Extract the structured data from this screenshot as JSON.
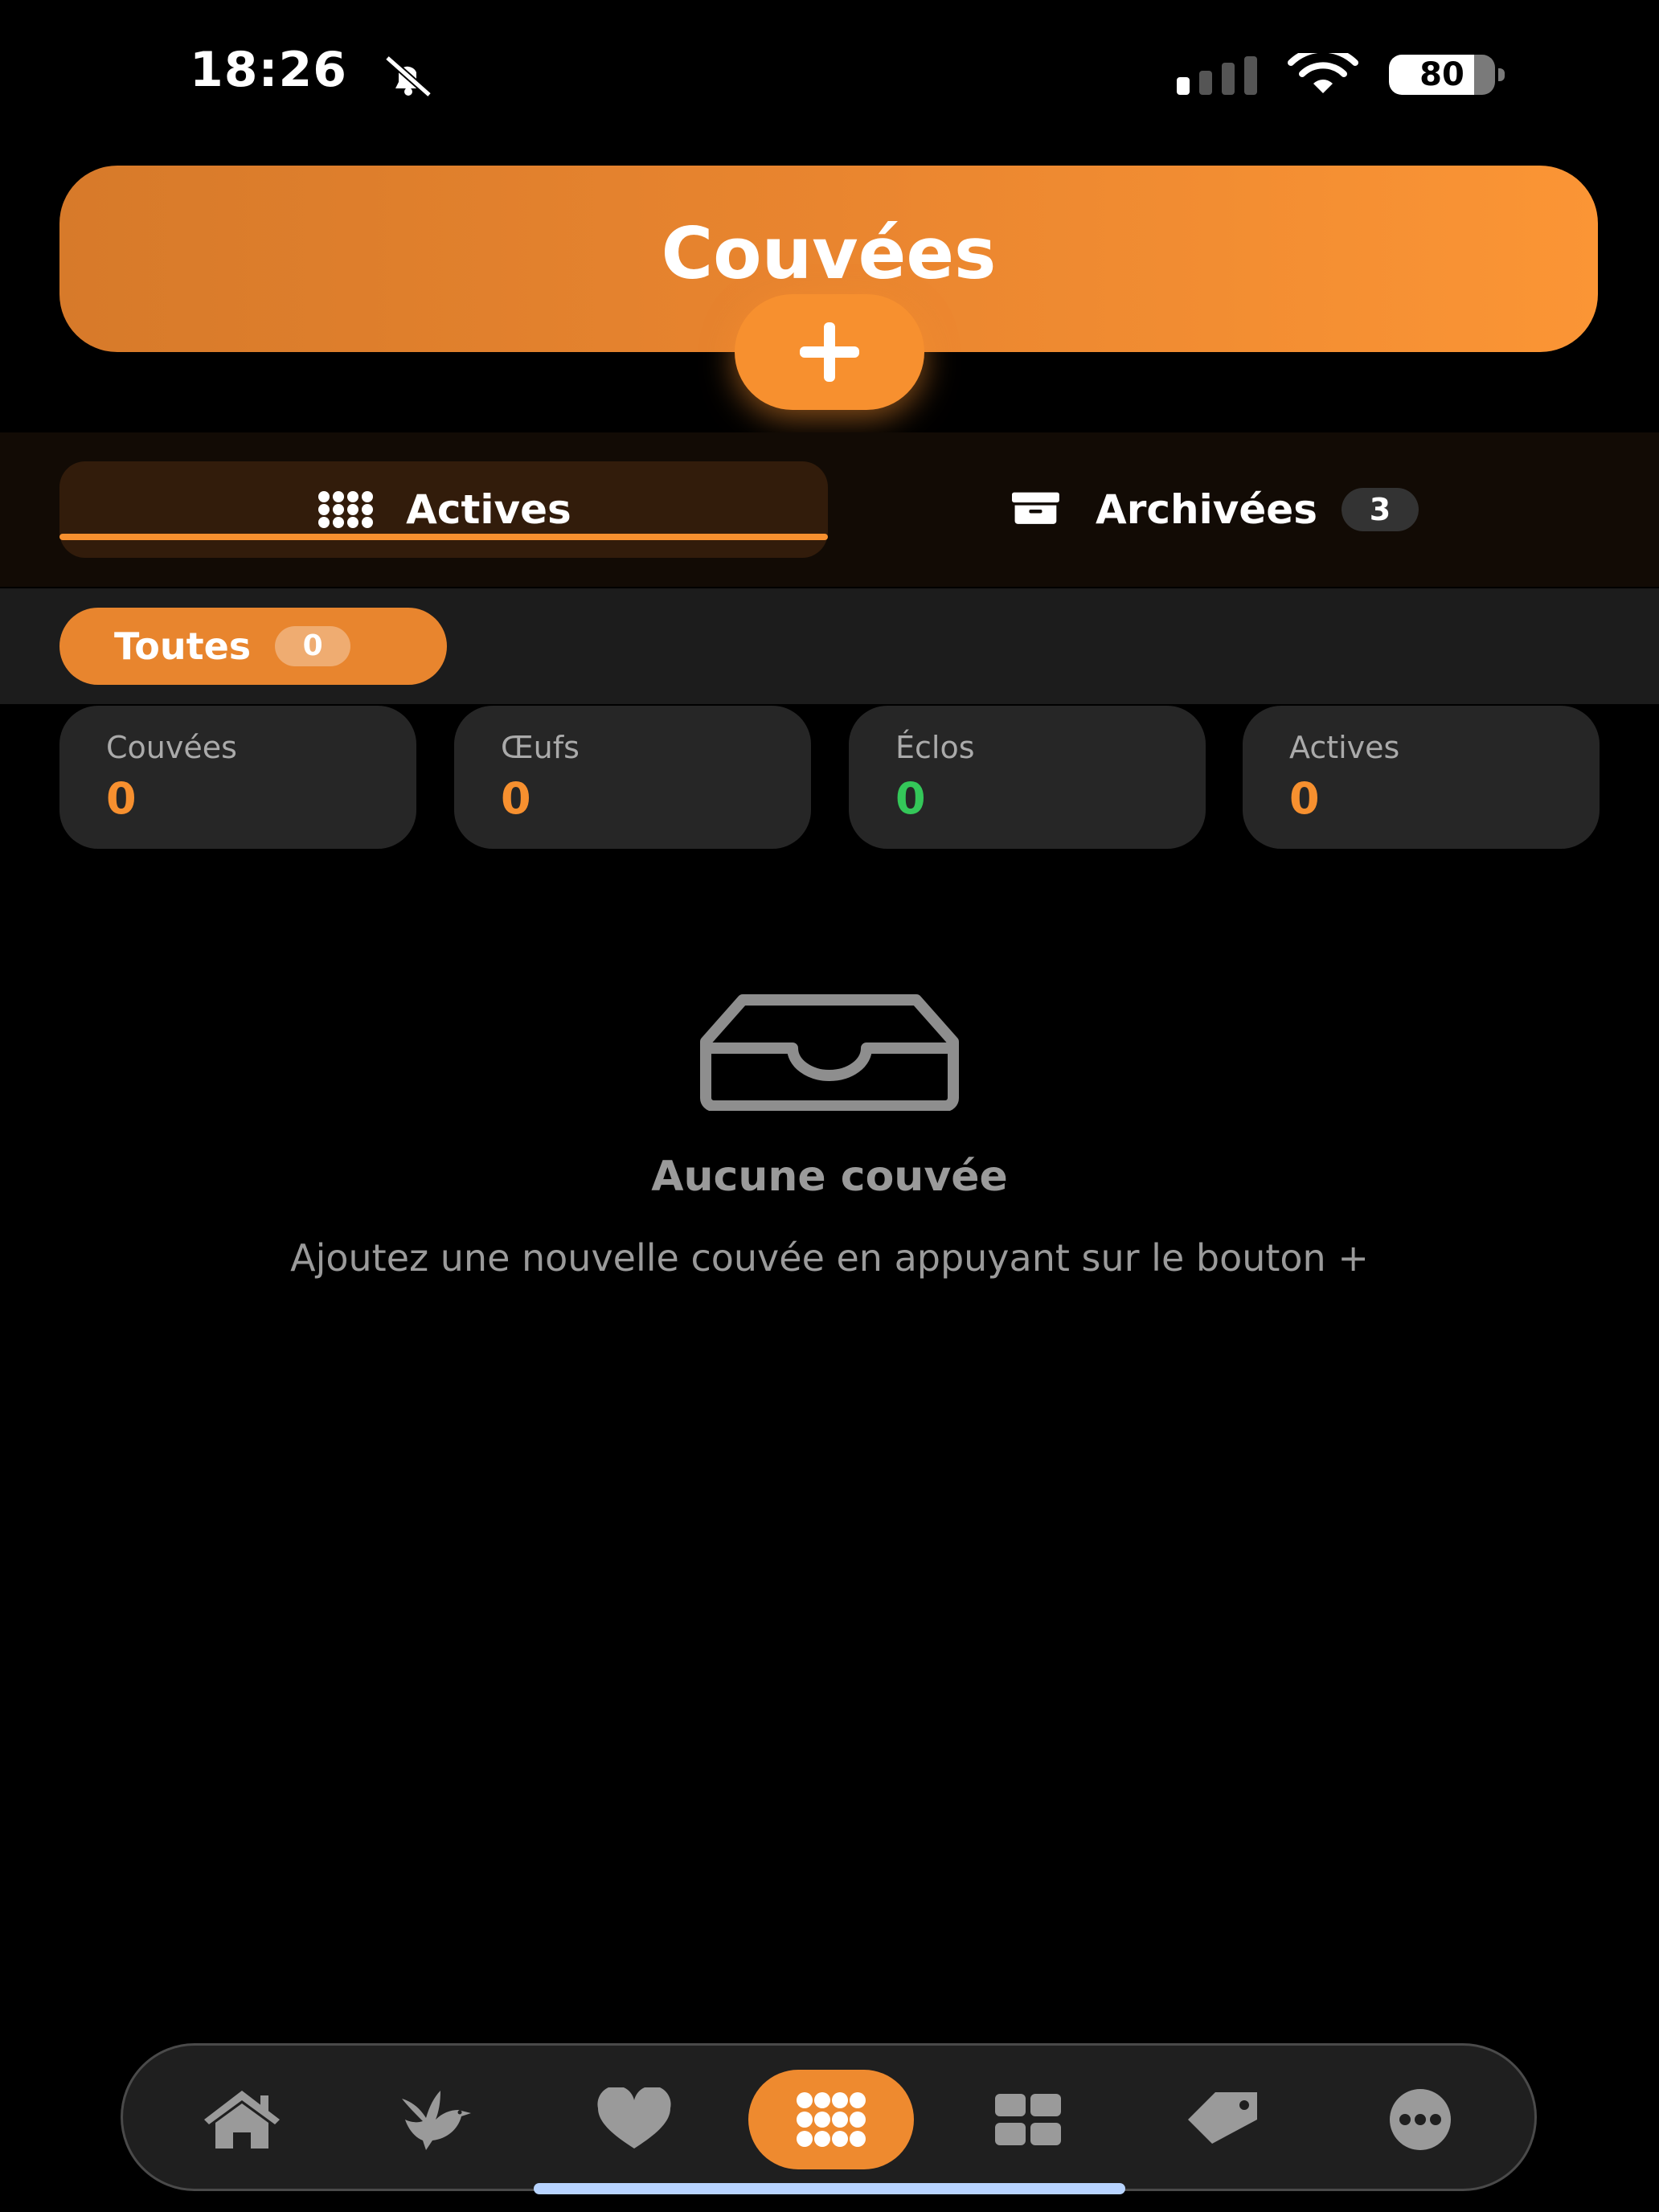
{
  "status_bar": {
    "time": "18:26",
    "battery_level": "80",
    "battery_fraction": 0.8
  },
  "header": {
    "title": "Couvées",
    "add_label": "+",
    "accent_color": "#f7902f"
  },
  "tabs": [
    {
      "label": "Actives",
      "icon": "grid-dots-icon",
      "active": true
    },
    {
      "label": "Archivées",
      "icon": "archive-box-icon",
      "count": "3",
      "active": false
    }
  ],
  "filter": {
    "label": "Toutes",
    "count": "0"
  },
  "stats": [
    {
      "label": "Couvées",
      "value": "0",
      "color": "#f7902f"
    },
    {
      "label": "Œufs",
      "value": "0",
      "color": "#f7902f"
    },
    {
      "label": "Éclos",
      "value": "0",
      "color": "#34c759"
    },
    {
      "label": "Actives",
      "value": "0",
      "color": "#f7902f"
    }
  ],
  "empty_state": {
    "icon": "inbox-tray-icon",
    "title": "Aucune couvée",
    "text": "Ajoutez une nouvelle couvée en appuyant sur le bouton +"
  },
  "bottom_nav": [
    {
      "icon": "home-icon"
    },
    {
      "icon": "bird-icon"
    },
    {
      "icon": "heart-icon"
    },
    {
      "icon": "grid-dots-icon",
      "active": true
    },
    {
      "icon": "dashboard-grid-icon"
    },
    {
      "icon": "tag-icon"
    },
    {
      "icon": "more-dots-icon"
    }
  ]
}
